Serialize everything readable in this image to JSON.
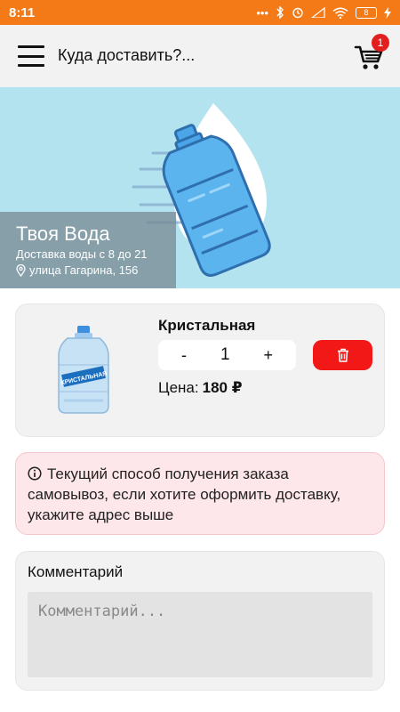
{
  "status_bar": {
    "time": "8:11",
    "battery": "8"
  },
  "header": {
    "menu_icon": "hamburger-menu-icon",
    "address_prompt": "Куда доставить?...",
    "cart_icon": "shopping-cart-icon",
    "cart_count": "1"
  },
  "banner": {
    "image": "water-bottle-illustration"
  },
  "store": {
    "name": "Твоя Вода",
    "hours": "Доставка воды с 8 до 21",
    "address": "улица Гагарина, 156",
    "location_icon": "map-pin-icon"
  },
  "cart_item": {
    "name": "Кристальная",
    "decrement": "-",
    "quantity": "1",
    "increment": "+",
    "price_label": "Цена:",
    "price_value": "180 ₽",
    "delete_icon": "trash-icon"
  },
  "notice": {
    "icon": "info-icon",
    "text": "Текущий способ получения заказа самовывоз, если хотите оформить доставку, укажите адрес выше"
  },
  "comment": {
    "title": "Комментарий",
    "placeholder": "Комментарий..."
  },
  "colors": {
    "status_bar": "#f37a16",
    "banner": "#b4e3f0",
    "delete_button": "#f21818",
    "cart_badge": "#e21f1f",
    "notice_bg": "#fde7ea"
  }
}
